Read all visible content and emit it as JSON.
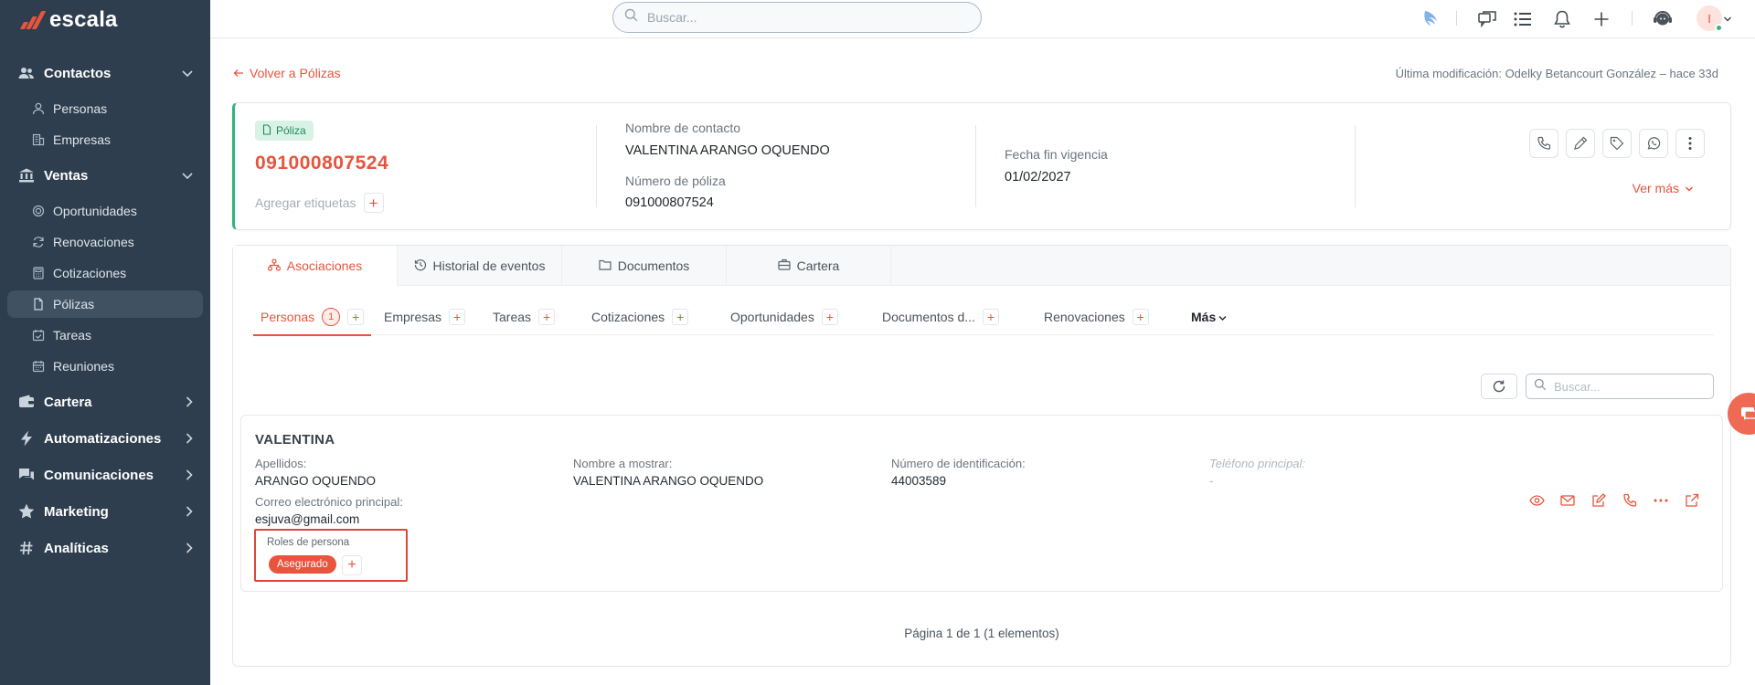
{
  "app": {
    "brand": "escala",
    "accent": "#e8543e",
    "sidebar_bg": "#2e3e4e"
  },
  "sidebar": {
    "sections": [
      {
        "label": "Contactos",
        "icon": "users-icon",
        "expanded": true
      },
      {
        "label": "Ventas",
        "icon": "bank-icon",
        "expanded": true
      },
      {
        "label": "Cartera",
        "icon": "wallet-icon",
        "expanded": false
      },
      {
        "label": "Automatizaciones",
        "icon": "bolt-icon",
        "expanded": false
      },
      {
        "label": "Comunicaciones",
        "icon": "chat-icon",
        "expanded": false
      },
      {
        "label": "Marketing",
        "icon": "star-icon",
        "expanded": false
      },
      {
        "label": "Analíticas",
        "icon": "hash-icon",
        "expanded": false
      }
    ],
    "contactos_items": [
      {
        "label": "Personas",
        "icon": "person-icon"
      },
      {
        "label": "Empresas",
        "icon": "building-icon"
      }
    ],
    "ventas_items": [
      {
        "label": "Oportunidades",
        "icon": "target-icon"
      },
      {
        "label": "Renovaciones",
        "icon": "refresh-icon"
      },
      {
        "label": "Cotizaciones",
        "icon": "calculator-icon"
      },
      {
        "label": "Pólizas",
        "icon": "document-icon",
        "active": true
      },
      {
        "label": "Tareas",
        "icon": "checkbox-calendar-icon"
      },
      {
        "label": "Reuniones",
        "icon": "calendar-icon"
      }
    ]
  },
  "topbar": {
    "search_placeholder": "Buscar...",
    "avatar_initial": "I"
  },
  "header": {
    "back_label": "Volver a Pólizas",
    "last_modified": "Última modificación: Odelky Betancourt González – hace 33d"
  },
  "policy": {
    "badge": "Póliza",
    "number": "091000807524",
    "tags_label": "Agregar etiquetas",
    "contact_name_label": "Nombre de contacto",
    "contact_name": "VALENTINA ARANGO OQUENDO",
    "policy_number_label": "Número de póliza",
    "policy_number": "091000807524",
    "end_date_label": "Fecha fin vigencia",
    "end_date": "01/02/2027",
    "ver_mas": "Ver más"
  },
  "main_tabs": [
    {
      "label": "Asociaciones",
      "icon": "hierarchy-icon",
      "active": true
    },
    {
      "label": "Historial de eventos",
      "icon": "history-icon"
    },
    {
      "label": "Documentos",
      "icon": "folder-icon"
    },
    {
      "label": "Cartera",
      "icon": "briefcase-icon"
    }
  ],
  "sub_tabs": [
    {
      "label": "Personas",
      "count": "1",
      "active": true
    },
    {
      "label": "Empresas"
    },
    {
      "label": "Tareas"
    },
    {
      "label": "Cotizaciones"
    },
    {
      "label": "Oportunidades"
    },
    {
      "label": "Documentos d..."
    },
    {
      "label": "Renovaciones"
    }
  ],
  "more_tab": "Más",
  "list_search_placeholder": "Buscar...",
  "person": {
    "first_name": "VALENTINA",
    "apellidos_label": "Apellidos:",
    "apellidos": "ARANGO OQUENDO",
    "display_label": "Nombre a mostrar:",
    "display": "VALENTINA ARANGO OQUENDO",
    "id_label": "Número de identificación:",
    "id": "44003589",
    "phone_label": "Teléfono principal:",
    "phone": "-",
    "email_label": "Correo electrónico principal:",
    "email": "esjuva@gmail.com",
    "roles_label": "Roles de persona",
    "role": "Asegurado"
  },
  "pagination": "Página 1 de 1 (1 elementos)"
}
